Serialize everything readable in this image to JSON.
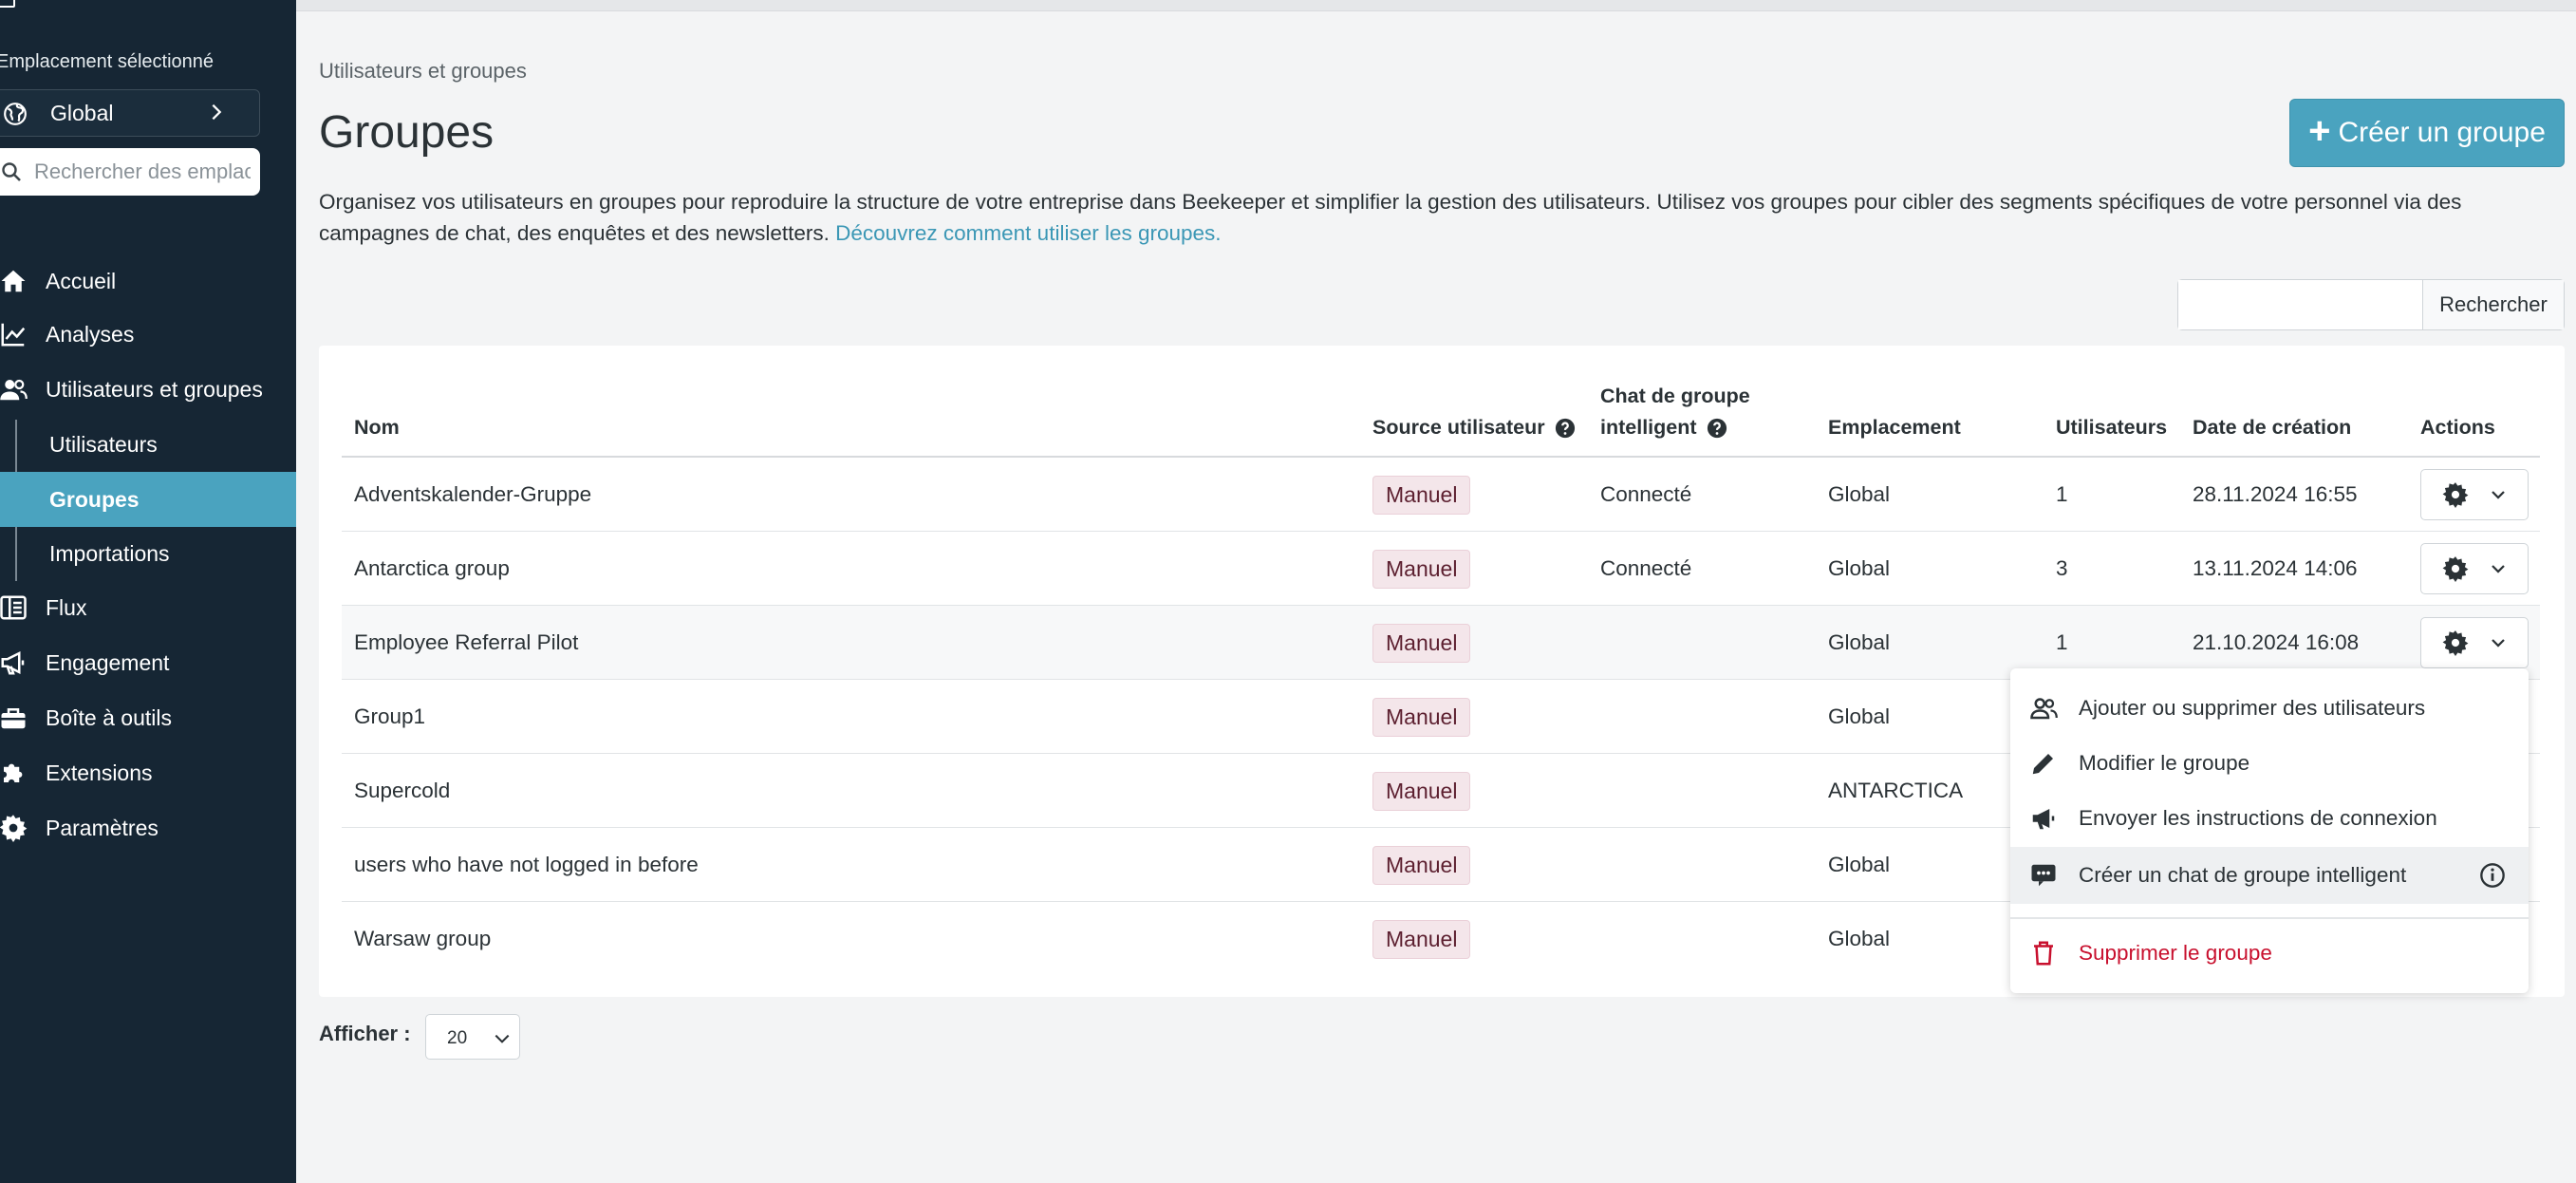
{
  "sidebar": {
    "location_label": "Emplacement sélectionné",
    "location_value": "Global",
    "search_placeholder": "Rechercher des emplacements",
    "nav": {
      "accueil": "Accueil",
      "analyses": "Analyses",
      "utilisateurs_groupes": "Utilisateurs et groupes",
      "utilisateurs": "Utilisateurs",
      "groupes": "Groupes",
      "importations": "Importations",
      "flux": "Flux",
      "engagement": "Engagement",
      "boite": "Boîte à outils",
      "extensions": "Extensions",
      "parametres": "Paramètres"
    }
  },
  "header": {
    "breadcrumb": "Utilisateurs et groupes",
    "title": "Groupes",
    "create_button": "Créer un groupe"
  },
  "description": {
    "text": "Organisez vos utilisateurs en groupes pour reproduire la structure de votre entreprise dans Beekeeper et simplifier la gestion des utilisateurs. Utilisez vos groupes pour cibler des segments spécifiques de votre personnel via des campagnes de chat, des enquêtes et des newsletters.",
    "link": "Découvrez comment utiliser les groupes."
  },
  "search": {
    "value": "",
    "button": "Rechercher"
  },
  "table": {
    "headers": {
      "nom": "Nom",
      "source": "Source utilisateur",
      "chat_line1": "Chat de groupe",
      "chat_line2": "intelligent",
      "emplacement": "Emplacement",
      "utilisateurs": "Utilisateurs",
      "date": "Date de création",
      "actions": "Actions"
    },
    "rows": [
      {
        "nom": "Adventskalender-Gruppe",
        "source": "Manuel",
        "chat": "Connecté",
        "emplacement": "Global",
        "utilisateurs": "1",
        "date": "28.11.2024 16:55"
      },
      {
        "nom": "Antarctica group",
        "source": "Manuel",
        "chat": "Connecté",
        "emplacement": "Global",
        "utilisateurs": "3",
        "date": "13.11.2024 14:06"
      },
      {
        "nom": "Employee Referral Pilot",
        "source": "Manuel",
        "chat": "",
        "emplacement": "Global",
        "utilisateurs": "1",
        "date": "21.10.2024 16:08"
      },
      {
        "nom": "Group1",
        "source": "Manuel",
        "chat": "",
        "emplacement": "Global",
        "utilisateurs": "",
        "date": ""
      },
      {
        "nom": "Supercold",
        "source": "Manuel",
        "chat": "",
        "emplacement": "ANTARCTICA",
        "utilisateurs": "",
        "date": ""
      },
      {
        "nom": "users who have not logged in before",
        "source": "Manuel",
        "chat": "",
        "emplacement": "Global",
        "utilisateurs": "",
        "date": ""
      },
      {
        "nom": "Warsaw group",
        "source": "Manuel",
        "chat": "",
        "emplacement": "Global",
        "utilisateurs": "",
        "date": ""
      }
    ]
  },
  "pagination": {
    "label": "Afficher :",
    "value": "20"
  },
  "dropdown": {
    "items": {
      "add_remove": "Ajouter ou supprimer des utilisateurs",
      "edit": "Modifier le groupe",
      "send_login": "Envoyer les instructions de connexion",
      "create_chat": "Créer un chat de groupe intelligent",
      "delete": "Supprimer le groupe"
    }
  },
  "colors": {
    "sidebar_bg": "#162634",
    "accent": "#4aa3bf",
    "badge_bg": "#f4e6ea",
    "badge_text": "#5c1f2f",
    "danger": "#c8102e"
  },
  "icons": {
    "location": "globe-icon",
    "home": "home-icon",
    "analyses": "line-chart-icon",
    "users": "users-icon",
    "flux": "feed-icon",
    "engagement": "megaphone-icon",
    "toolbox": "toolbox-icon",
    "extensions": "puzzle-icon",
    "settings": "gear-icon"
  }
}
